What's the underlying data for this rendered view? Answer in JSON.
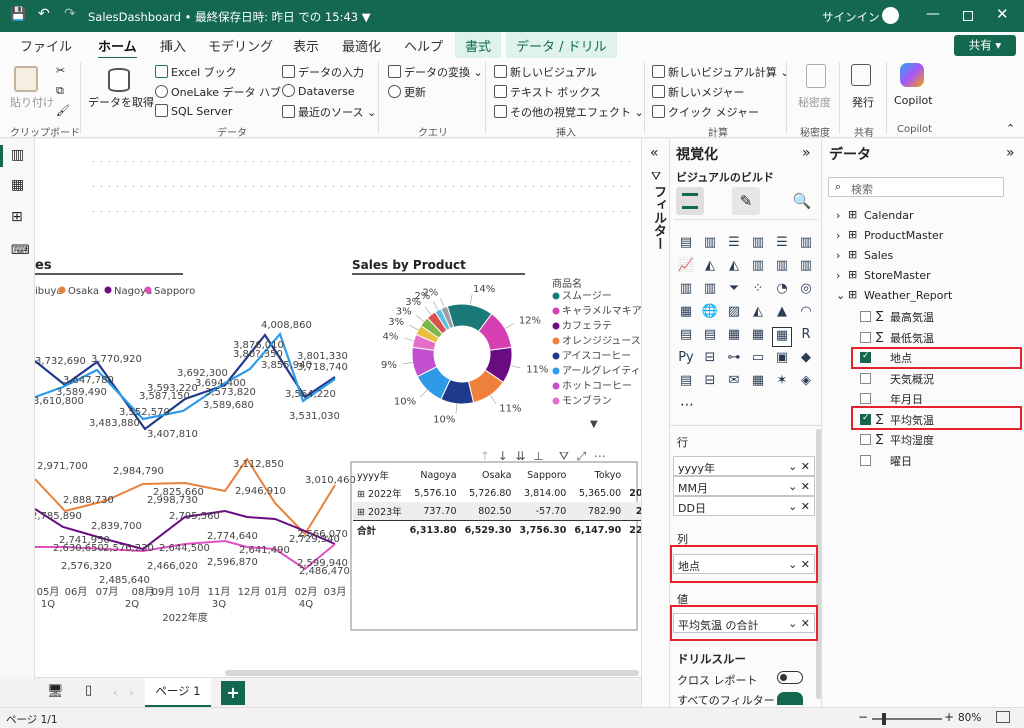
{
  "title": {
    "doc": "SalesDashboard • 最終保存日時: 昨日 での 15:43 ▼",
    "signin": "サインイン",
    "share": "共有 ▾"
  },
  "menu": {
    "file": "ファイル",
    "home": "ホーム",
    "insert": "挿入",
    "modeling": "モデリング",
    "view": "表示",
    "optimize": "最適化",
    "help": "ヘルプ",
    "format": "書式",
    "data_drill": "データ / ドリル"
  },
  "ribbon": {
    "paste": "貼り付け",
    "clipboard": "クリップボード",
    "get_data": "データを取得",
    "excel": "Excel ブック",
    "onelake": "OneLake データ ハブ",
    "sql": "SQL Server",
    "enter_data": "データの入力",
    "dataverse": "Dataverse",
    "recent": "最近のソース",
    "data_group": "データ",
    "transform": "データの変換",
    "refresh": "更新",
    "query_group": "クエリ",
    "new_visual": "新しいビジュアル",
    "textbox": "テキスト ボックス",
    "more_visuals": "その他の視覚エフェクト",
    "insert_group": "挿入",
    "new_calc": "新しいビジュアル計算",
    "new_measure": "新しいメジャー",
    "quick_measure": "クイック メジャー",
    "calc_group": "計算",
    "sensitivity": "秘密度",
    "sensitivity_group": "秘密度",
    "publish": "発行",
    "share_group": "共有",
    "copilot": "Copilot",
    "copilot_group": "Copilot"
  },
  "chart_left": {
    "title_fragment": "es",
    "legend": [
      "ibuya",
      "Osaka",
      "Nagoya",
      "Sapporo"
    ],
    "legend_colors": [
      "#1f3a8a",
      "#e8823a",
      "#6a0d83",
      "#e14fc0"
    ],
    "top_labels": [
      "3,732,690",
      "3,610,800",
      "3,647,780",
      "3,589,490",
      "3,483,880",
      "3,770,920",
      "3,552,570",
      "3,593,220",
      "3,587,150",
      "3,407,810",
      "3,692,300",
      "3,694,400",
      "3,573,820",
      "3,589,680",
      "3,876,010",
      "3,80?,350",
      "4,008,860",
      "3,855,940",
      "3,801,330",
      "3,718,740",
      "3,564,220",
      "3,531,030"
    ],
    "bottom_labels": [
      "2,971,700",
      "2,785,890",
      "2,888,730",
      "2,839,700",
      "2,984,790",
      "2,998,730",
      "2,825,660",
      "2,795,560",
      "3,112,850",
      "2,946,910",
      "3,010,460",
      "2,630,650",
      "2,741,950",
      "2,576,230",
      "2,644,500",
      "2,774,640",
      "2,596,870",
      "2,641,490",
      "2,729,340",
      "2,666,070",
      "2,599,940",
      "2,486,470",
      "2,576,320",
      "2,485,640",
      "2,466,020"
    ],
    "x_months": [
      "05月",
      "06月",
      "07月",
      "08月",
      "09月",
      "10月",
      "11月",
      "12月",
      "01月",
      "02月",
      "03月"
    ],
    "x_quarters": [
      "1Q",
      "2Q",
      "3Q",
      "4Q"
    ],
    "x_year": "2022年度"
  },
  "chart_data": {
    "type": "pie",
    "title": "Sales by Product",
    "legend_title": "商品名",
    "categories": [
      "スムージー",
      "キャラメルマキアー...",
      "カフェラテ",
      "オレンジジュース",
      "アイスコーヒー",
      "アールグレイティー",
      "ホットコーヒー",
      "モンブラン"
    ],
    "colors": [
      "#1b7a77",
      "#d63fb2",
      "#6a0d83",
      "#f0813a",
      "#1f3a8a",
      "#2f9be8",
      "#c34fcf",
      "#e46ec8"
    ],
    "values": [
      14,
      12,
      11,
      11,
      10,
      10,
      9,
      4,
      3,
      3,
      3,
      2,
      2
    ],
    "labels": [
      "14%",
      "12%",
      "11%",
      "11%",
      "10%",
      "10%",
      "9%",
      "4%",
      "3%",
      "3%",
      "3%",
      "2%",
      "2%"
    ]
  },
  "table": {
    "headers": [
      "yyyy年",
      "Nagoya",
      "Osaka",
      "Sapporo",
      "Tokyo",
      "合計"
    ],
    "rows": [
      [
        "2022年",
        "5,576.10",
        "5,726.80",
        "3,814.00",
        "5,365.00",
        "20,481.90"
      ],
      [
        "2023年",
        "737.70",
        "802.50",
        "-57.70",
        "782.90",
        "2,265.40"
      ],
      [
        "合計",
        "6,313.80",
        "6,529.30",
        "3,756.30",
        "6,147.90",
        "22,747.30"
      ]
    ]
  },
  "page": {
    "tab": "ページ 1",
    "add": "+",
    "status": "ページ 1/1",
    "zoom": "80%"
  },
  "filters": {
    "label": "フィルター"
  },
  "viz": {
    "title": "視覚化",
    "build": "ビジュアルのビルド",
    "rows_label": "行",
    "rows": [
      "yyyy年",
      "MM月",
      "DD日"
    ],
    "cols_label": "列",
    "cols": [
      "地点"
    ],
    "values_label": "値",
    "values": [
      "平均気温 の合計"
    ],
    "drill_label": "ドリルスルー",
    "cross_report": "クロス レポート",
    "all_filters": "すべてのフィルター"
  },
  "data": {
    "title": "データ",
    "search_placeholder": "検索",
    "tables": [
      "Calendar",
      "ProductMaster",
      "Sales",
      "StoreMaster",
      "Weather_Report"
    ],
    "fields": [
      {
        "label": "最高気温",
        "sigma": true,
        "checked": false
      },
      {
        "label": "最低気温",
        "sigma": true,
        "checked": false
      },
      {
        "label": "地点",
        "sigma": false,
        "checked": true
      },
      {
        "label": "天気概況",
        "sigma": false,
        "checked": false
      },
      {
        "label": "年月日",
        "sigma": false,
        "checked": false
      },
      {
        "label": "平均気温",
        "sigma": true,
        "checked": true
      },
      {
        "label": "平均湿度",
        "sigma": true,
        "checked": false
      },
      {
        "label": "曜日",
        "sigma": false,
        "checked": false
      }
    ]
  }
}
